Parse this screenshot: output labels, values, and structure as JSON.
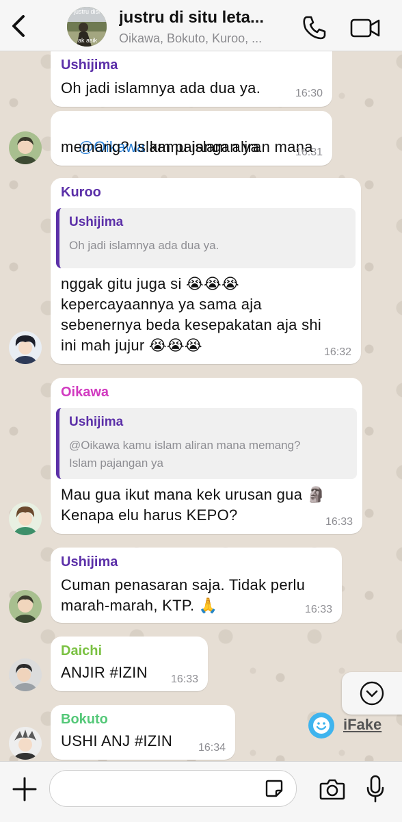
{
  "header": {
    "back_label": "back",
    "group_name": "justru di situ leta...",
    "members": "Oikawa, Bokuto, Kuroo, ...",
    "avatar_caption_top": "justru disi",
    "avatar_caption_bottom": "ak asik"
  },
  "messages": [
    {
      "sender": "Ushijima",
      "text": "Oh jadi islamnya ada dua ya.",
      "time": "16:30"
    },
    {
      "mention": "@Oikawa",
      "text_line1": " kamu islam aliran mana",
      "text_line2": "memang? Islam pajangan ya",
      "time": "16:31"
    },
    {
      "sender": "Kuroo",
      "quote_name": "Ushijima",
      "quote_text": "Oh jadi islamnya ada dua ya.",
      "text": "nggak gitu juga si 😭😭😭\nkepercayaannya ya sama aja\nsebenernya beda kesepakatan aja shi\nini mah jujur 😭😭😭",
      "time": "16:32"
    },
    {
      "sender": "Oikawa",
      "quote_name": "Ushijima",
      "quote_text": "@Oikawa kamu islam aliran mana memang?\nIslam pajangan ya",
      "text": "Mau gua ikut mana kek urusan gua 🗿\nKenapa elu harus KEPO?",
      "time": "16:33"
    },
    {
      "sender": "Ushijima",
      "text": "Cuman penasaran saja. Tidak perlu\nmarah-marah, KTP. 🙏",
      "time": "16:33"
    },
    {
      "sender": "Daichi",
      "text": "ANJIR #IZIN",
      "time": "16:33"
    },
    {
      "sender": "Bokuto",
      "text": "USHI ANJ #IZIN",
      "time": "16:34"
    }
  ],
  "watermark": {
    "label": "iFake"
  },
  "colors": {
    "ushijima": "#5b2fa8",
    "kuroo": "#5b2fa8",
    "oikawa": "#d13ac0",
    "daichi": "#7ac142",
    "bokuto": "#54c878"
  }
}
